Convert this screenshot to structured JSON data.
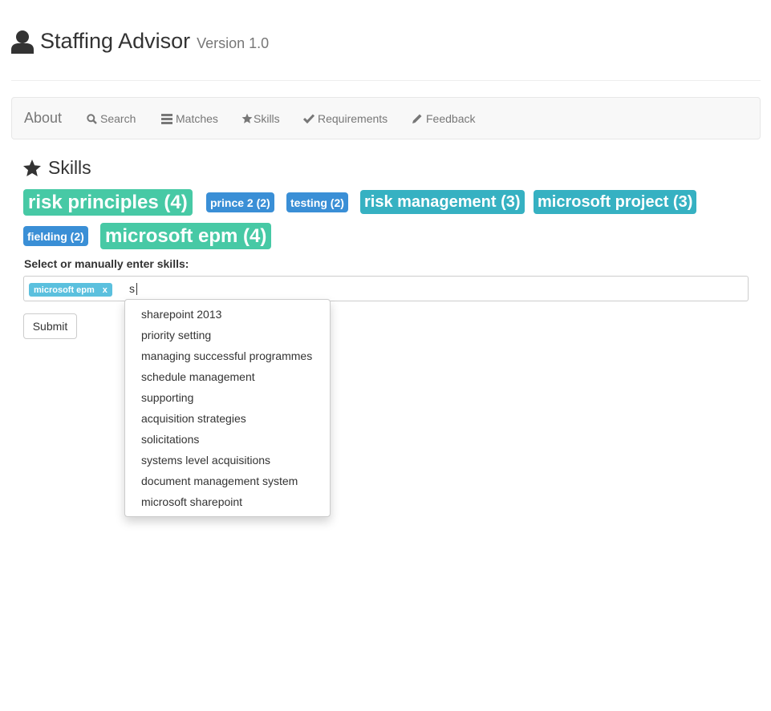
{
  "header": {
    "title": "Staffing Advisor",
    "version": "Version 1.0"
  },
  "nav": {
    "brand": "About",
    "items": [
      {
        "label": "Search",
        "icon": "search-icon"
      },
      {
        "label": "Matches",
        "icon": "list-icon"
      },
      {
        "label": "Skills",
        "icon": "star-icon"
      },
      {
        "label": "Requirements",
        "icon": "check-icon"
      },
      {
        "label": "Feedback",
        "icon": "pencil-icon"
      }
    ]
  },
  "skills_section": {
    "title": "Skills",
    "tags": [
      {
        "label": "risk principles (4)",
        "color": "#47c9a5"
      },
      {
        "label": "prince 2 (2)",
        "color": "#3a8fd6"
      },
      {
        "label": "testing (2)",
        "color": "#3a8fd6"
      },
      {
        "label": "risk management (3)",
        "color": "#36b1c2"
      },
      {
        "label": "microsoft project (3)",
        "color": "#36b1c2"
      },
      {
        "label": "fielding (2)",
        "color": "#3a8fd6"
      },
      {
        "label": "microsoft epm (4)",
        "color": "#47c9a5"
      }
    ]
  },
  "form": {
    "label": "Select or manually enter skills:",
    "chips": [
      {
        "label": "microsoft epm",
        "remove": "x"
      }
    ],
    "typed": "s",
    "suggestions": [
      "sharepoint 2013",
      "priority setting",
      "managing successful programmes",
      "schedule management",
      "supporting",
      "acquisition strategies",
      "solicitations",
      "systems level acquisitions",
      "document management system",
      "microsoft sharepoint"
    ],
    "submit_label": "Submit"
  }
}
